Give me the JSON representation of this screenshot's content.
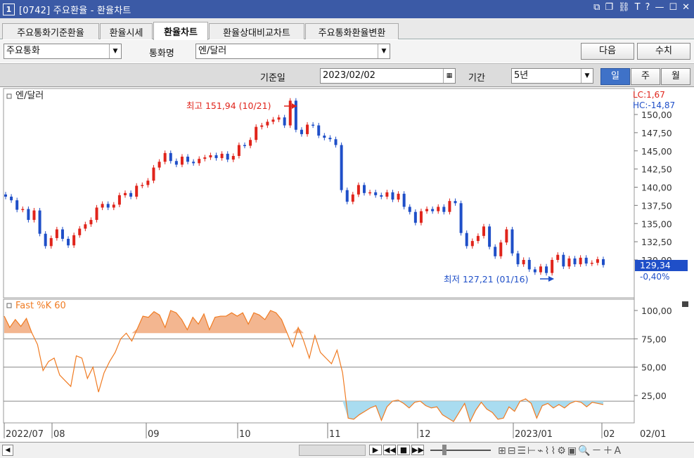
{
  "window": {
    "number": "1",
    "title": "[0742] 주요환율 - 환율차트",
    "icons": [
      "restore-icon",
      "new-window-icon",
      "link-icon",
      "font-icon",
      "help-icon",
      "minimize-icon",
      "maximize-icon",
      "close-icon"
    ]
  },
  "tabs": [
    {
      "label": "주요통화기준환율"
    },
    {
      "label": "환율시세"
    },
    {
      "label": "환율차트",
      "active": true
    },
    {
      "label": "환율상대비교차트"
    },
    {
      "label": "주요통화환율변환"
    }
  ],
  "controls": {
    "group_select": "주요통화",
    "currency_label": "통화명",
    "currency_select": "엔/달러",
    "next_button": "다음",
    "lookup_button": "수치",
    "base_date_label": "기준일",
    "base_date": "2023/02/02",
    "period_label": "기간",
    "period_select": "5년",
    "period_buttons": [
      "일",
      "주",
      "월"
    ]
  },
  "chart": {
    "title": "엔/달러",
    "lc_label": "LC:1,67",
    "hc_label": "HC:-14,87",
    "high_annotation": "최고 151,94 (10/21)",
    "low_annotation": "최저 127,21 (01/16)",
    "last_price": "129,34",
    "change_pct": "-0,40%",
    "price_ticks": [
      "150,00",
      "147,50",
      "145,00",
      "142,50",
      "140,00",
      "137,50",
      "135,00",
      "132,50",
      "130,00"
    ],
    "indicator_title": "Fast %K 60",
    "indicator_ticks": [
      "100,00",
      "75,00",
      "50,00",
      "25,00"
    ],
    "x_labels": [
      "2022/07",
      "08",
      "09",
      "10",
      "11",
      "12",
      "2023/01",
      "02"
    ],
    "end_label": "02/01",
    "colors": {
      "up": "#e0241b",
      "down": "#1f4fc8",
      "overbought_fill": "#f3b690",
      "oversold_fill": "#a9dcf0",
      "k_line": "#f07b22"
    }
  },
  "chart_data": [
    {
      "type": "candlestick",
      "title": "엔/달러",
      "y_range": [
        126.5,
        151.5
      ],
      "x": [
        "2022/07",
        "08",
        "09",
        "10",
        "11",
        "12",
        "2023/01",
        "02"
      ],
      "series": [
        {
          "values": [
            138.7,
            138.2,
            136.9,
            137.0,
            135.5,
            136.8,
            133.6,
            131.9,
            133.0,
            134.2,
            132.9,
            132.0,
            133.4,
            134.3,
            134.9,
            135.5,
            137.2,
            137.7,
            137.2,
            137.6,
            138.9,
            139.2,
            138.7,
            140.2,
            140.3,
            140.9,
            142.7,
            143.5,
            144.7,
            143.6,
            143.1,
            144.2,
            143.5,
            143.3,
            143.9,
            144.1,
            144.4,
            144.0,
            144.6,
            143.8,
            144.3,
            145.8,
            145.7,
            146.5,
            148.3,
            148.5,
            149.0,
            149.3,
            149.6,
            148.5,
            151.9,
            147.9,
            147.3,
            148.6,
            148.5,
            147.1,
            146.8,
            146.6,
            145.8,
            139.6,
            138.0,
            139.0,
            140.3,
            139.2,
            139.3,
            138.9,
            138.7,
            139.3,
            138.3,
            139.1,
            137.3,
            136.6,
            135.1,
            136.7,
            137.0,
            136.7,
            137.3,
            136.6,
            138.1,
            137.8,
            133.7,
            131.9,
            132.6,
            133.3,
            134.6,
            131.8,
            130.5,
            132.4,
            134.2,
            130.9,
            129.4,
            130.0,
            128.7,
            128.3,
            129.1,
            128.2,
            130.0,
            130.7,
            129.1,
            130.2,
            129.4,
            130.3,
            129.5,
            129.6,
            130.1,
            129.3
          ]
        }
      ]
    },
    {
      "type": "area",
      "title": "Fast %K 60",
      "y_range": [
        0,
        105
      ],
      "reference_lines": [
        75,
        50,
        20
      ],
      "x": [
        "2022/07",
        "08",
        "09",
        "10",
        "11",
        "12",
        "2023/01",
        "02"
      ],
      "series": [
        {
          "name": "Fast %K 60",
          "values": [
            95,
            85,
            92,
            86,
            93,
            80,
            70,
            47,
            55,
            58,
            43,
            38,
            33,
            60,
            58,
            40,
            50,
            28,
            45,
            55,
            63,
            75,
            80,
            73,
            84,
            95,
            94,
            99,
            96,
            85,
            100,
            98,
            92,
            83,
            94,
            88,
            97,
            83,
            94,
            95,
            95,
            98,
            95,
            98,
            88,
            98,
            96,
            92,
            100,
            98,
            92,
            80,
            68,
            85,
            73,
            58,
            78,
            63,
            58,
            53,
            65,
            45,
            5,
            4,
            8,
            11,
            14,
            16,
            3,
            15,
            20,
            21,
            18,
            14,
            19,
            20,
            16,
            14,
            15,
            8,
            5,
            2,
            10,
            18,
            2,
            12,
            19,
            13,
            10,
            4,
            5,
            15,
            11,
            20,
            22,
            18,
            5,
            16,
            18,
            14,
            17,
            14,
            18,
            20,
            19,
            15,
            19,
            18,
            17
          ]
        }
      ]
    }
  ]
}
